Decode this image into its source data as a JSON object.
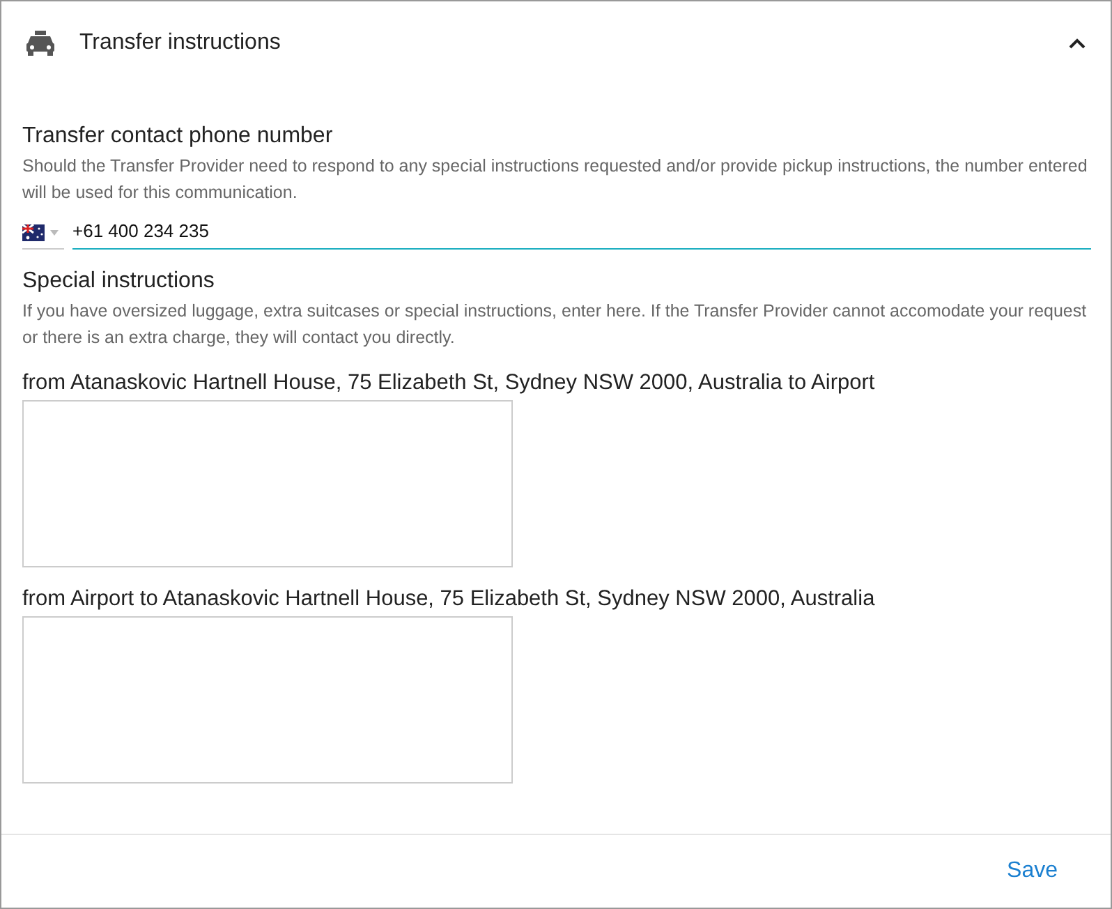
{
  "panel": {
    "title": "Transfer instructions",
    "expanded": true
  },
  "phone": {
    "label": "Transfer contact phone number",
    "description": "Should the Transfer Provider need to respond to any special instructions requested and/or provide pickup instructions, the number entered will be used for this communication.",
    "value": "+61 400 234 235"
  },
  "special": {
    "label": "Special instructions",
    "description": "If you have oversized luggage, extra suitcases or special instructions, enter here. If the Transfer Provider cannot accomodate your request or there is an extra charge, they will contact you directly.",
    "trips": [
      {
        "label": "from Atanaskovic Hartnell House, 75 Elizabeth St, Sydney NSW 2000, Australia to Airport"
      },
      {
        "label": "from Airport to Atanaskovic Hartnell House, 75 Elizabeth St, Sydney NSW 2000, Australia"
      }
    ]
  },
  "footer": {
    "save": "Save"
  }
}
